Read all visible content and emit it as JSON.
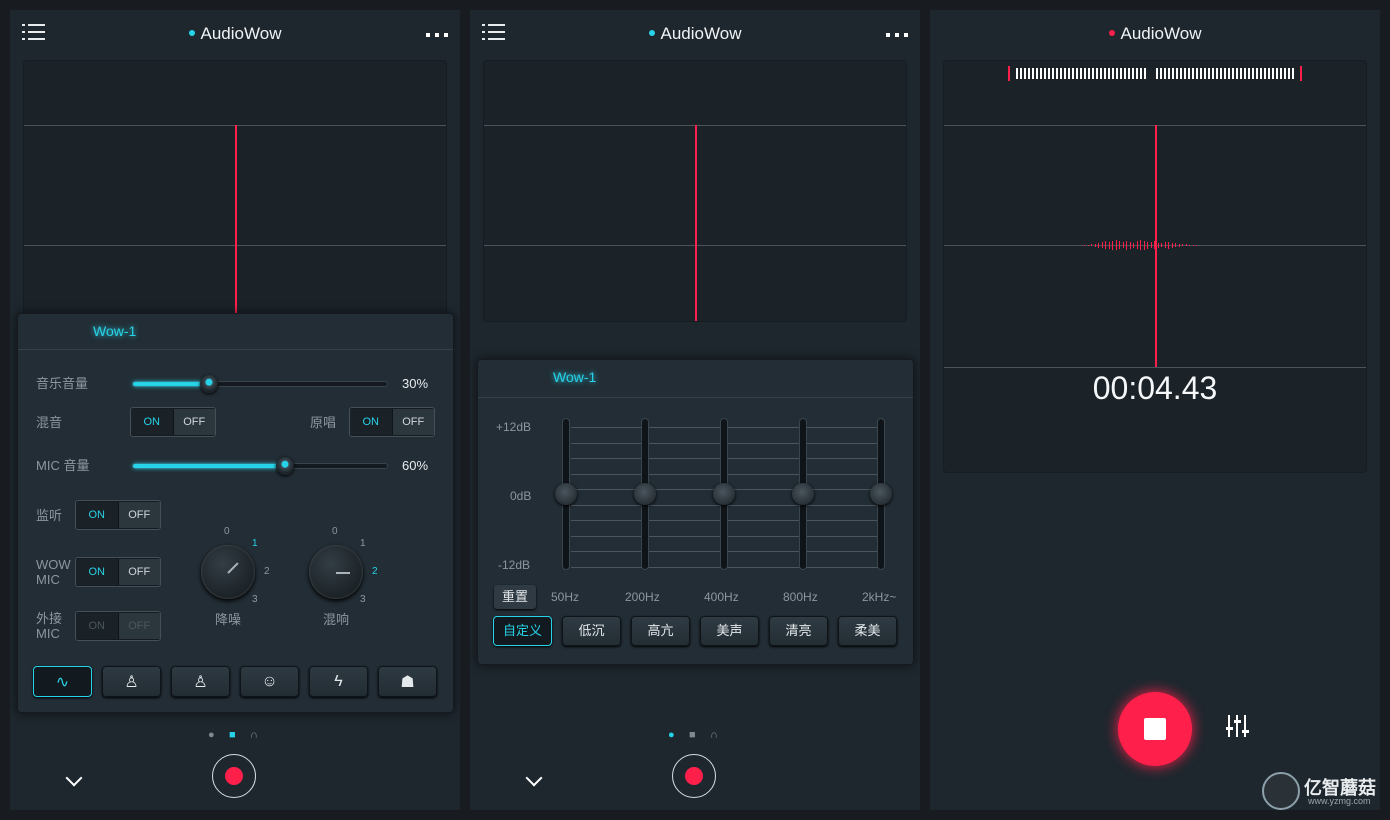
{
  "app": {
    "title": "AudioWow"
  },
  "screen1": {
    "tab": "Wow-1",
    "music_volume": {
      "label": "音乐音量",
      "value_text": "30%",
      "value": 0.3
    },
    "mix": {
      "label": "混音",
      "on": "ON",
      "off": "OFF"
    },
    "original": {
      "label": "原唱",
      "on": "ON",
      "off": "OFF"
    },
    "mic_volume": {
      "label": "MIC 音量",
      "value_text": "60%",
      "value": 0.6
    },
    "monitor": {
      "label": "监听",
      "on": "ON",
      "off": "OFF"
    },
    "wow_mic": {
      "label": "WOW MIC",
      "on": "ON",
      "off": "OFF"
    },
    "ext_mic": {
      "label": "外接 MIC",
      "on": "ON",
      "off": "OFF"
    },
    "denoise": {
      "label": "降噪",
      "ticks": [
        "0",
        "1",
        "2",
        "3"
      ],
      "selected": "1"
    },
    "reverb": {
      "label": "混响",
      "ticks": [
        "0",
        "1",
        "2",
        "3"
      ],
      "selected": "2"
    },
    "effects": [
      "waveform-icon",
      "person-icon",
      "person-outline-icon",
      "face-icon",
      "lightning-icon",
      "robot-icon"
    ],
    "sources": [
      "mic-icon",
      "chip-icon",
      "headphone-icon"
    ]
  },
  "screen2": {
    "tab": "Wow-1",
    "db_labels": [
      "+12dB",
      "0dB",
      "-12dB"
    ],
    "reset": "重置",
    "bands": [
      "50Hz",
      "200Hz",
      "400Hz",
      "800Hz",
      "2kHz~"
    ],
    "gains": [
      0,
      0,
      0,
      0,
      0
    ],
    "presets": [
      "自定义",
      "低沉",
      "高亢",
      "美声",
      "清亮",
      "柔美"
    ],
    "active_preset": "自定义"
  },
  "screen3": {
    "timer": "00:04.43"
  },
  "watermark": {
    "name": "亿智蘑菇",
    "url": "www.yzmg.com"
  },
  "colors": {
    "accent": "#27d3e8",
    "record": "#ff1f4b",
    "background": "#1e272e"
  }
}
